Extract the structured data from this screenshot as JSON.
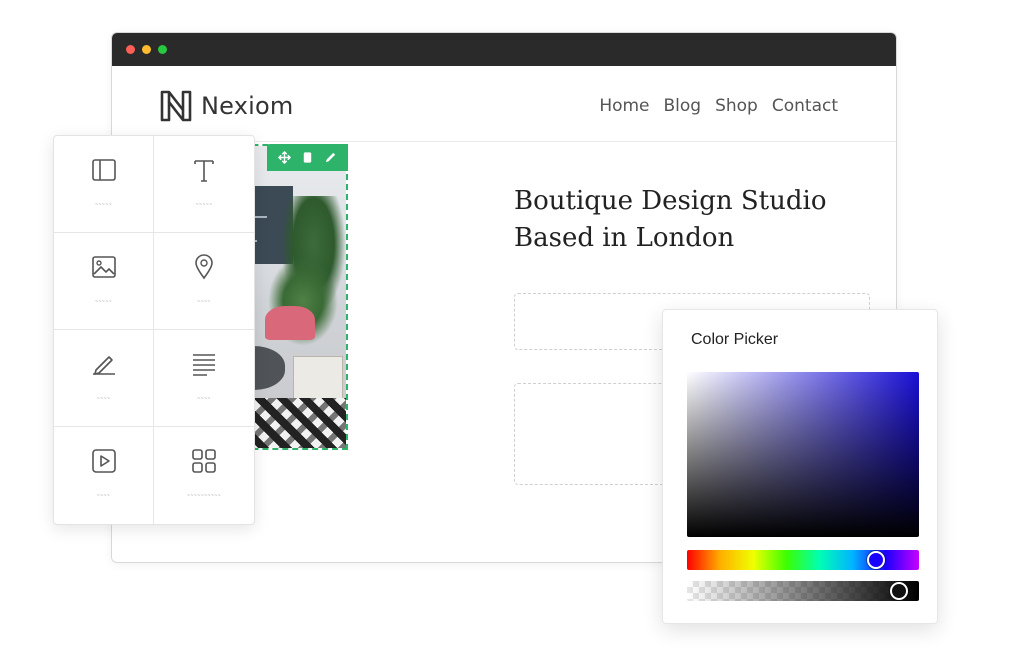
{
  "site": {
    "brand": "Nexiom",
    "nav": [
      "Home",
      "Blog",
      "Shop",
      "Contact"
    ]
  },
  "hero": {
    "heading_line1": "Boutique Design Studio",
    "heading_line2": "Based in London"
  },
  "image_toolbar": {
    "icons": [
      "move-icon",
      "duplicate-icon",
      "edit-pencil-icon"
    ],
    "accent_color": "#2eb36a"
  },
  "widgets": [
    {
      "icon": "layout-icon",
      "label": "~~~~~"
    },
    {
      "icon": "text-icon",
      "label": "~~~~~"
    },
    {
      "icon": "image-icon",
      "label": "~~~~~"
    },
    {
      "icon": "map-pin-icon",
      "label": "~~~~"
    },
    {
      "icon": "signature-icon",
      "label": "~~~~"
    },
    {
      "icon": "paragraph-icon",
      "label": "~~~~"
    },
    {
      "icon": "video-play-icon",
      "label": "~~~~"
    },
    {
      "icon": "grid-icon",
      "label": "~~~~~~~~~~"
    }
  ],
  "color_picker": {
    "title": "Color Picker",
    "selected_color": "#1a10d6",
    "hue_position": 0.84,
    "alpha_position": 0.95
  },
  "window_controls": {
    "close_color": "#ff5f57",
    "minimize_color": "#febc2e",
    "maximize_color": "#28c840"
  }
}
